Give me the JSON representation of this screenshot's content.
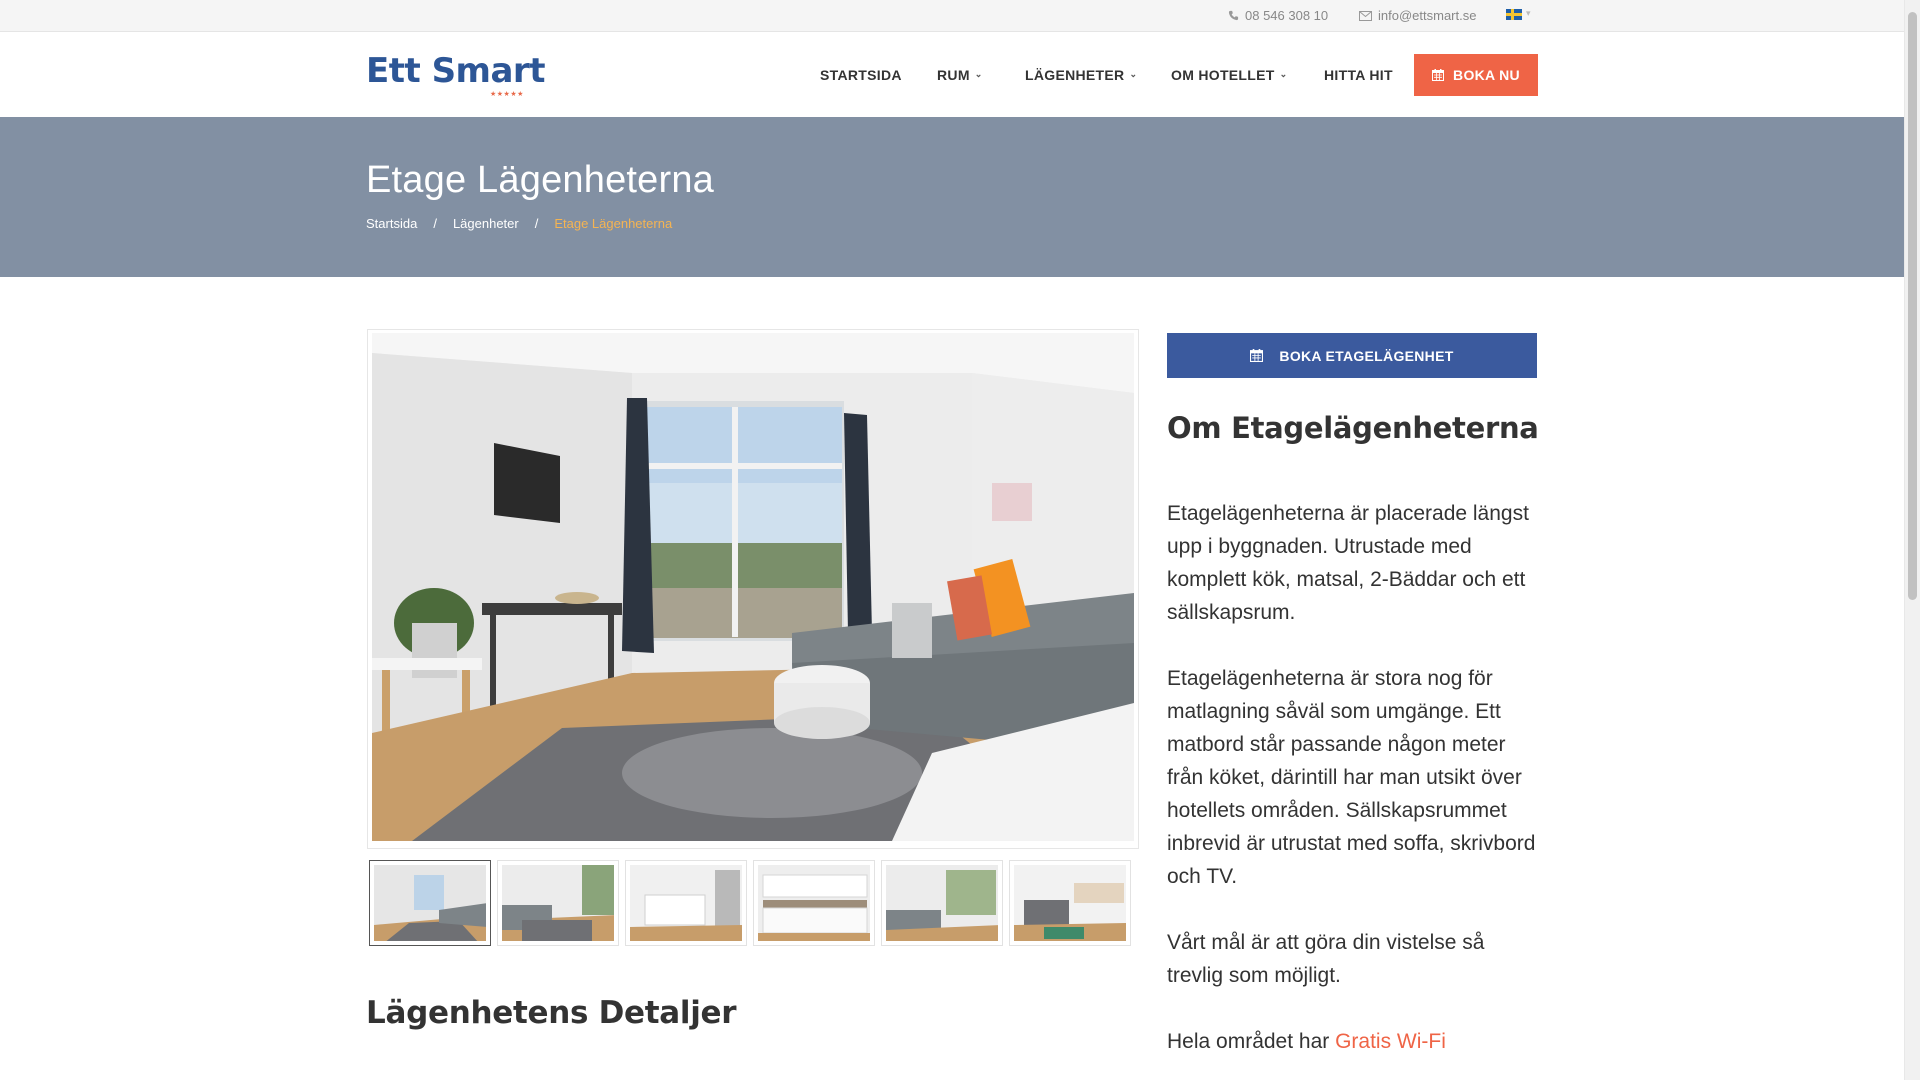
{
  "topbar": {
    "phone": "08 546 308 10",
    "email": "info@ettsmart.se",
    "language": "sv"
  },
  "header": {
    "logo_text": "Ett Smart",
    "logo_stars": "★★★★★",
    "nav": [
      {
        "label": "STARTSIDA",
        "has_dropdown": false
      },
      {
        "label": "RUM",
        "has_dropdown": true
      },
      {
        "label": "LÄGENHETER",
        "has_dropdown": true
      },
      {
        "label": "OM HOTELLET",
        "has_dropdown": true
      },
      {
        "label": "HITTA HIT",
        "has_dropdown": false
      }
    ],
    "book_label": "BOKA NU"
  },
  "banner": {
    "title": "Etage Lägenheterna",
    "breadcrumb": [
      "Startsida",
      "Lägenheter",
      "Etage Lägenheterna"
    ],
    "separator": "/"
  },
  "gallery": {
    "thumbnails_count": 6,
    "active_index": 0
  },
  "details_heading": "Lägenhetens Detaljer",
  "sidebar": {
    "book_label": "BOKA ETAGELÄGENHET",
    "about_heading": "Om Etagelägenheterna",
    "paragraphs": [
      "Etagelägenheterna är placerade längst upp i byggnaden. Utrustade med komplett kök, matsal, 2-Bäddar och ett sällskapsrum.",
      "Etagelägenheterna är stora nog för matlagning såväl som umgänge. Ett matbord står passande någon meter från köket, därintill har man utsikt över hotellets områden. Sällskapsrummet inbrevid är utrustat med soffa, skrivbord och TV.",
      "Vårt mål är att göra din vistelse så trevlig som möjligt."
    ],
    "wifi_prefix": "Hela området har",
    "wifi_link": "Gratis Wi-Fi"
  },
  "colors": {
    "brand_blue": "#2d5696",
    "accent_orange": "#ef6446",
    "banner_gray": "#8290a3",
    "breadcrumb_active": "#f5b452",
    "book_blue": "#3b5a9e"
  }
}
